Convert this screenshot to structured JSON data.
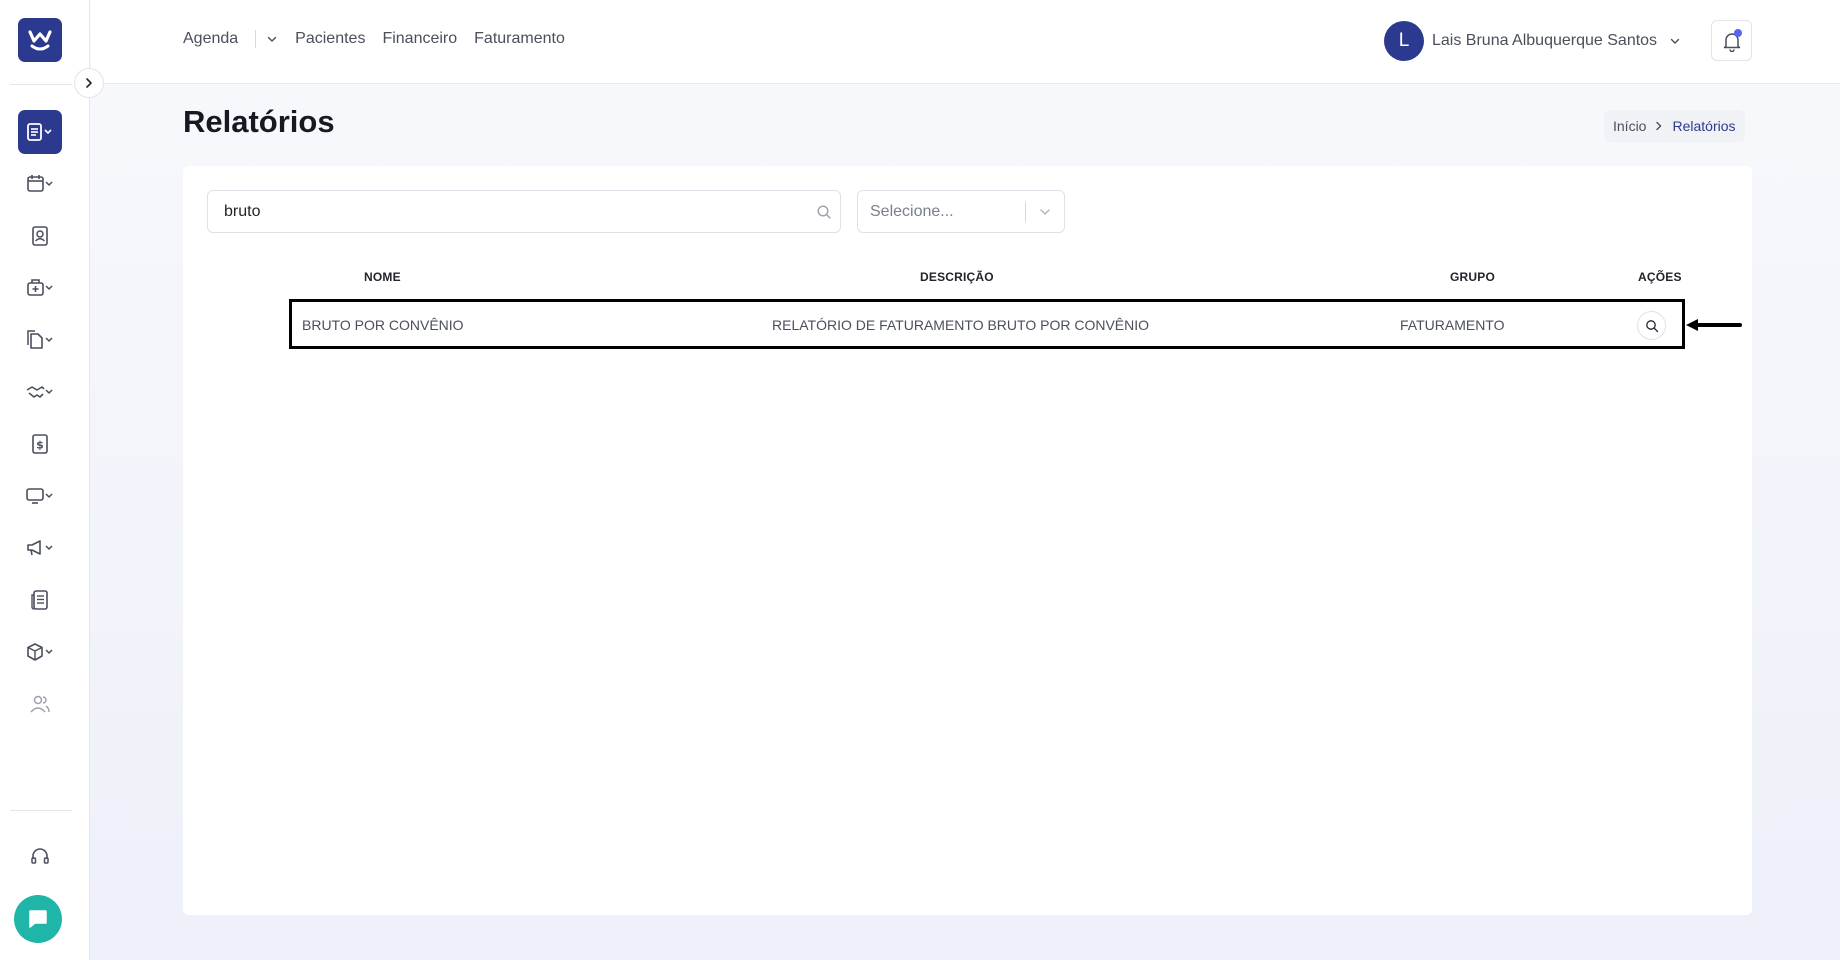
{
  "topnav": {
    "agenda": "Agenda",
    "pacientes": "Pacientes",
    "financeiro": "Financeiro",
    "faturamento": "Faturamento"
  },
  "user": {
    "initial": "L",
    "name": "Lais Bruna Albuquerque Santos"
  },
  "page": {
    "title": "Relatórios"
  },
  "breadcrumb": {
    "home": "Início",
    "current": "Relatórios"
  },
  "filters": {
    "search_value": "bruto",
    "select_placeholder": "Selecione..."
  },
  "table": {
    "headers": {
      "nome": "NOME",
      "descricao": "DESCRIÇÃO",
      "grupo": "GRUPO",
      "acoes": "AÇÕES"
    },
    "rows": [
      {
        "nome": "BRUTO POR CONVÊNIO",
        "descricao": "RELATÓRIO DE FATURAMENTO BRUTO POR CONVÊNIO",
        "grupo": "FATURAMENTO"
      }
    ]
  },
  "colors": {
    "brand": "#2b3a8f",
    "chat": "#1fb5a8",
    "notification_dot": "#5865f2"
  },
  "icons": {
    "sidebar": [
      "reports-icon",
      "calendar-icon",
      "patient-badge-icon",
      "medical-bag-icon",
      "documents-icon",
      "handshake-icon",
      "dollar-icon",
      "monitor-icon",
      "megaphone-icon",
      "newspaper-icon",
      "box-icon",
      "users-icon",
      "headset-icon",
      "chat-icon"
    ]
  }
}
